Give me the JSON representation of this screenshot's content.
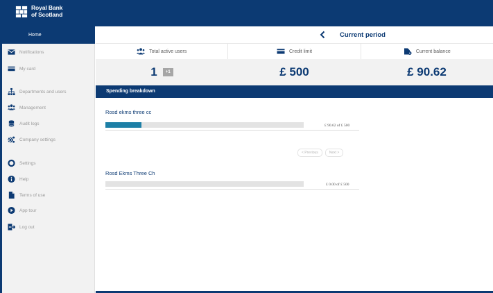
{
  "brand": {
    "name_line1": "Royal Bank",
    "name_line2": "of Scotland"
  },
  "sidebar": {
    "home_label": "Home",
    "items": [
      {
        "label": "Notifications",
        "icon": "envelope-icon"
      },
      {
        "label": "My card",
        "icon": "card-icon"
      },
      {
        "label": "Departments and users",
        "icon": "org-chart-icon"
      },
      {
        "label": "Management",
        "icon": "users-icon"
      },
      {
        "label": "Audit logs",
        "icon": "database-icon"
      },
      {
        "label": "Company settings",
        "icon": "gears-icon"
      },
      {
        "label": "Settings",
        "icon": "settings-icon"
      },
      {
        "label": "Help",
        "icon": "info-icon"
      },
      {
        "label": "Terms of use",
        "icon": "document-icon"
      },
      {
        "label": "App tour",
        "icon": "play-icon"
      },
      {
        "label": "Log out",
        "icon": "logout-icon"
      }
    ]
  },
  "header": {
    "title": "Current period"
  },
  "stats": {
    "active_users_label": "Total active users",
    "credit_limit_label": "Credit limit",
    "current_balance_label": "Current balance",
    "active_users_value": "1",
    "active_users_badge": "+1",
    "credit_limit_value": "£ 500",
    "current_balance_value": "£ 90.62"
  },
  "spending": {
    "title": "Spending breakdown",
    "cards": [
      {
        "name": "Rosd ekms three cc",
        "amount_text": "£ 90.62 of £ 500",
        "spent": 90.62,
        "limit": 500
      },
      {
        "name": "Rosd Ekms Three Ch",
        "amount_text": "£ 0.00 of £ 500",
        "spent": 0,
        "limit": 500
      }
    ],
    "pager": {
      "previous": "< Previous",
      "next": "Next >"
    }
  },
  "colors": {
    "brand_navy": "#0c3a73",
    "bar_fill": "#1d7fa6",
    "sidebar_bg": "#f2f2f2"
  }
}
